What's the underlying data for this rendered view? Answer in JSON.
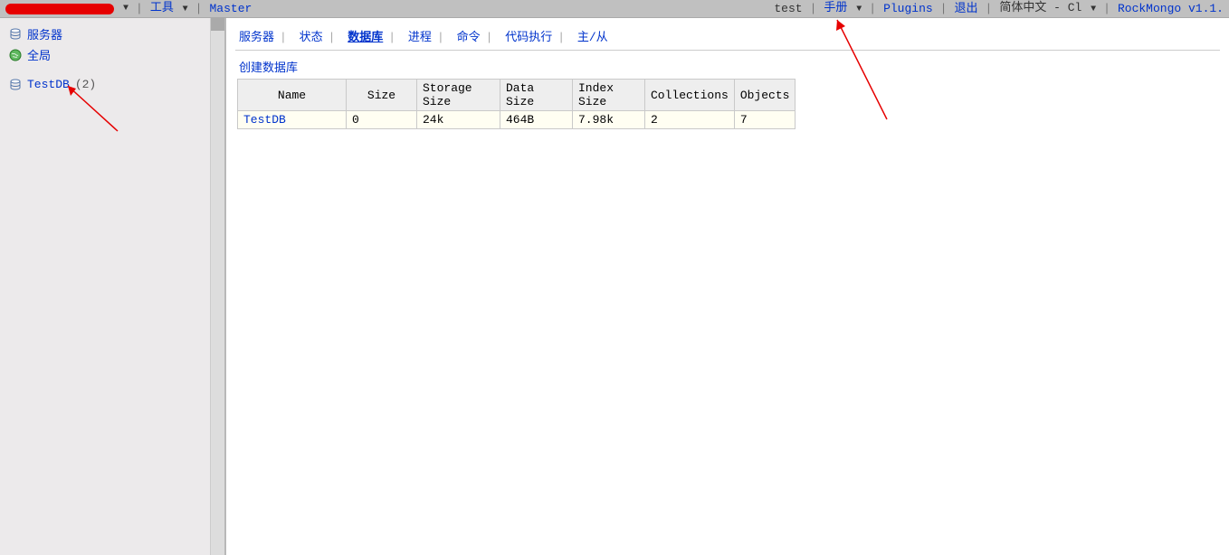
{
  "topbar": {
    "left": {
      "tools": "工具",
      "master": "Master"
    },
    "right": {
      "user": "test",
      "manual": "手册",
      "plugins": "Plugins",
      "logout": "退出",
      "lang": "简体中文 - Cl",
      "version": "RockMongo v1.1."
    }
  },
  "sidebar": {
    "items": [
      {
        "label": "服务器",
        "icon": "database-icon"
      },
      {
        "label": "全局",
        "icon": "globe-icon"
      }
    ],
    "db": {
      "label": "TestDB",
      "count": "(2)",
      "icon": "database-icon"
    }
  },
  "tabs": [
    {
      "label": "服务器",
      "active": false
    },
    {
      "label": "状态",
      "active": false
    },
    {
      "label": "数据库",
      "active": true
    },
    {
      "label": "进程",
      "active": false
    },
    {
      "label": "命令",
      "active": false
    },
    {
      "label": "代码执行",
      "active": false
    },
    {
      "label": "主/从",
      "active": false
    }
  ],
  "create_db": "创建数据库",
  "table": {
    "headers": [
      "Name",
      "Size",
      "Storage Size",
      "Data Size",
      "Index Size",
      "Collections",
      "Objects"
    ],
    "rows": [
      {
        "name": "TestDB",
        "size": "0",
        "storage": "24k",
        "data": "464B",
        "index": "7.98k",
        "collections": "2",
        "objects": "7"
      }
    ]
  }
}
